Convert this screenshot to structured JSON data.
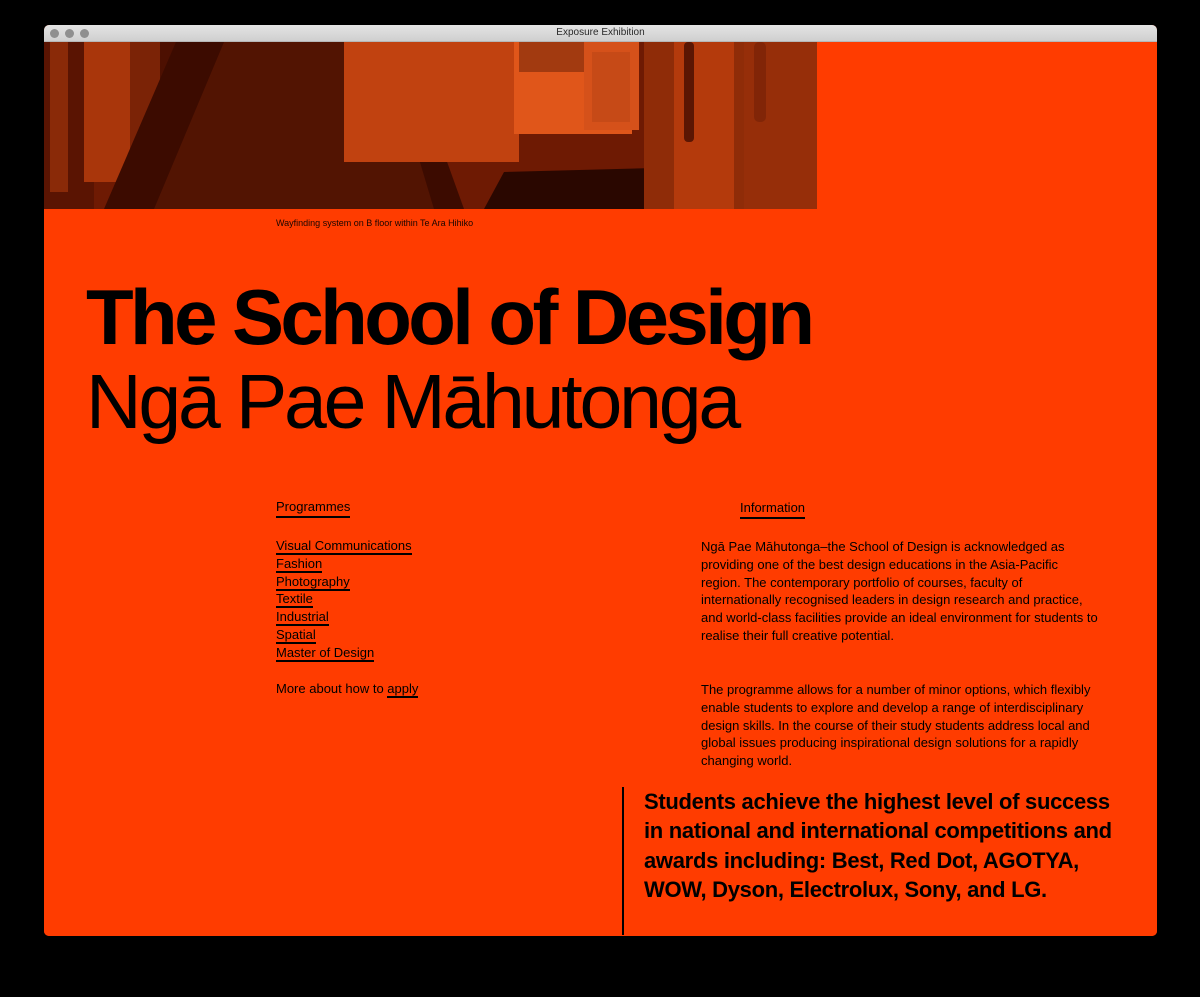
{
  "window": {
    "title": "Exposure Exhibition"
  },
  "photo": {
    "caption": "Wayfinding system on B floor within Te Ara Hihiko"
  },
  "heading": {
    "title": "The School of Design",
    "subtitle": "Ngā Pae Māhutonga"
  },
  "programmes": {
    "label": "Programmes",
    "items": [
      {
        "label": "Visual Communications"
      },
      {
        "label": "Fashion"
      },
      {
        "label": "Photography"
      },
      {
        "label": "Textile"
      },
      {
        "label": "Industrial"
      },
      {
        "label": "Spatial"
      },
      {
        "label": "Master of Design"
      }
    ],
    "apply_prefix": "More about how to ",
    "apply_link": "apply"
  },
  "information": {
    "label": "Information",
    "paragraphs": [
      "Ngā Pae Māhutonga–the School of Design is acknowledged as providing one of the best design educations in the Asia-Pacific region. The contemporary portfolio of courses, faculty of internationally recognised leaders in design research and practice, and world-class facilities provide an ideal environment for students to realise their full creative potential.",
      "The programme allows for a number of minor options, which flexibly enable students to explore and develop a range of interdisciplinary design skills. In the course of their study students address local and global issues producing inspirational design solutions for a rapidly changing world."
    ]
  },
  "quote": {
    "text": "Students achieve the highest level of success in national and international competitions and awards including: Best, Red Dot, AGOTYA, WOW, Dyson, Electrolux, Sony, and LG."
  },
  "colors": {
    "background": "#ff3c00",
    "text": "#000000",
    "page": "#000000"
  }
}
